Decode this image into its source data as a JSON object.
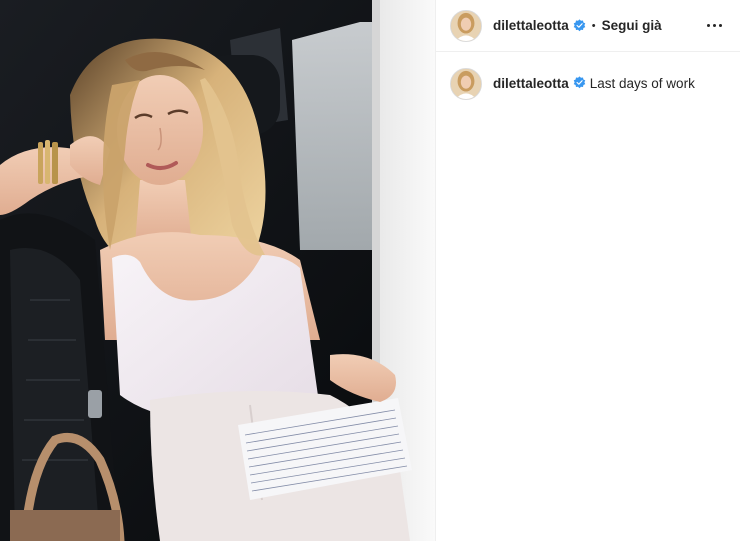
{
  "post": {
    "author": {
      "username": "dilettaleotta",
      "verified": true,
      "avatar_icon": "profile-avatar"
    },
    "header": {
      "separator": "•",
      "follow_status": "Segui già",
      "more_icon": "more-options-icon"
    },
    "caption": {
      "username": "dilettaleotta",
      "text": "Last days of work"
    },
    "photo": {
      "subject": "photo-woman-in-car"
    },
    "colors": {
      "verified_blue": "#3897f0",
      "text": "#262626",
      "divider": "#efefef"
    }
  }
}
